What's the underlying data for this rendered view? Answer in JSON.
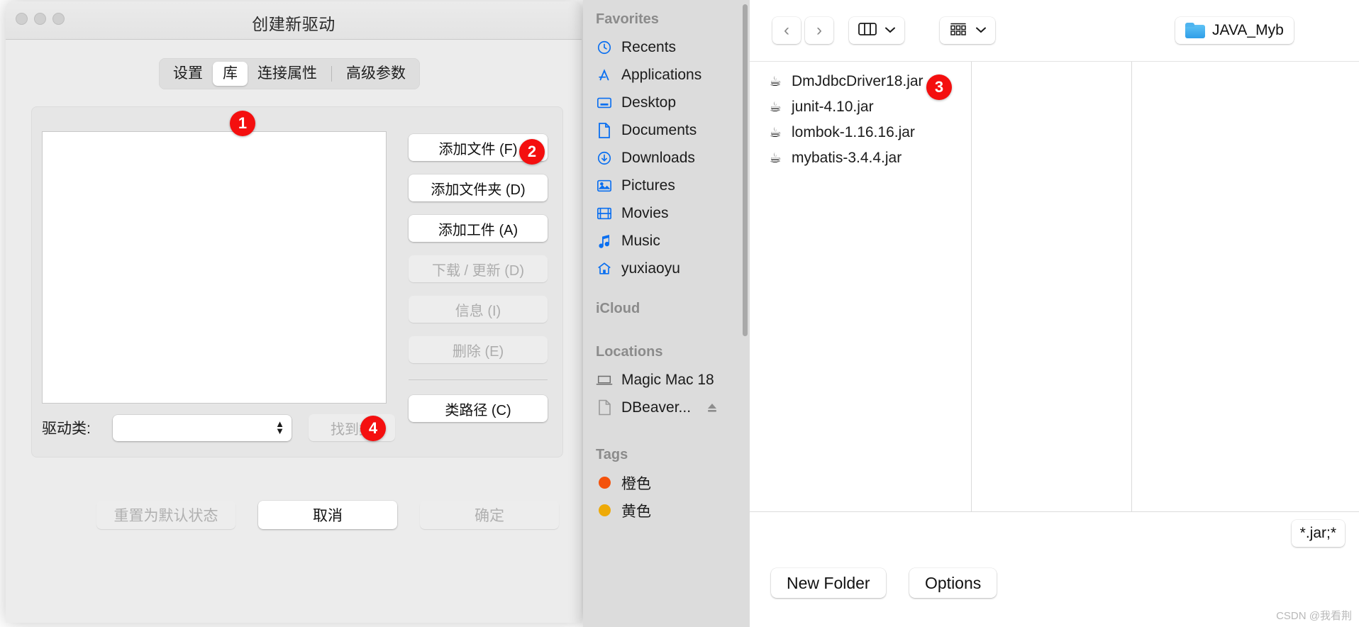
{
  "dialog": {
    "title": "创建新驱动",
    "tabs": [
      {
        "label": "设置",
        "active": false
      },
      {
        "label": "库",
        "active": true
      },
      {
        "label": "连接属性",
        "active": false
      },
      {
        "label": "高级参数",
        "active": false
      }
    ],
    "library_buttons": [
      {
        "label": "添加文件 (F)",
        "disabled": false
      },
      {
        "label": "添加文件夹 (D)",
        "disabled": false
      },
      {
        "label": "添加工件 (A)",
        "disabled": false
      },
      {
        "label": "下载 / 更新 (D)",
        "disabled": true
      },
      {
        "label": "信息 (I)",
        "disabled": true
      },
      {
        "label": "删除 (E)",
        "disabled": true
      }
    ],
    "classpath_button": "类路径 (C)",
    "driver_class_label": "驱动类:",
    "driver_class_value": "",
    "find_class_button": "找到类",
    "footer": {
      "reset": "重置为默认状态",
      "cancel": "取消",
      "ok": "确定"
    },
    "badges": [
      {
        "number": "1"
      },
      {
        "number": "2"
      },
      {
        "number": "3"
      },
      {
        "number": "4"
      }
    ]
  },
  "finder": {
    "sidebar": {
      "groups": [
        {
          "title": "Favorites",
          "items": [
            {
              "label": "Recents",
              "icon": "clock-icon",
              "color": "#0a6ff0"
            },
            {
              "label": "Applications",
              "icon": "appstore-icon",
              "color": "#0a6ff0"
            },
            {
              "label": "Desktop",
              "icon": "desktop-icon",
              "color": "#0a6ff0"
            },
            {
              "label": "Documents",
              "icon": "document-icon",
              "color": "#0a6ff0"
            },
            {
              "label": "Downloads",
              "icon": "download-icon",
              "color": "#0a6ff0"
            },
            {
              "label": "Pictures",
              "icon": "picture-icon",
              "color": "#0a6ff0"
            },
            {
              "label": "Movies",
              "icon": "film-icon",
              "color": "#0a6ff0"
            },
            {
              "label": "Music",
              "icon": "music-icon",
              "color": "#0a6ff0"
            },
            {
              "label": "yuxiaoyu",
              "icon": "home-icon",
              "color": "#0a6ff0"
            }
          ]
        },
        {
          "title": "iCloud",
          "items": []
        },
        {
          "title": "Locations",
          "items": [
            {
              "label": "Magic Mac 18",
              "icon": "laptop-icon",
              "color": "#777777"
            },
            {
              "label": "DBeaver...",
              "icon": "disk-image-icon",
              "color": "#9a9a9a",
              "eject": true
            }
          ]
        },
        {
          "title": "Tags",
          "items": [
            {
              "label": "橙色",
              "icon": "tag-dot-icon",
              "color": "#f4520c"
            },
            {
              "label": "黄色",
              "icon": "tag-dot-icon",
              "color": "#eeaa08"
            }
          ]
        }
      ]
    },
    "toolbar": {
      "back_icon": "chevron-left-icon",
      "forward_icon": "chevron-right-icon",
      "view_icon": "column-view-icon",
      "view_chevron": "chevron-down-icon",
      "group_icon": "group-view-icon",
      "group_chevron": "chevron-down-icon",
      "path_label": "JAVA_Myb",
      "path_icon": "folder-icon"
    },
    "files": [
      {
        "name": "DmJdbcDriver18.jar",
        "icon": "jar-icon"
      },
      {
        "name": "junit-4.10.jar",
        "icon": "jar-icon"
      },
      {
        "name": "lombok-1.16.16.jar",
        "icon": "jar-icon"
      },
      {
        "name": "mybatis-3.4.4.jar",
        "icon": "jar-icon"
      }
    ],
    "filter_value": "*.jar;*",
    "footer": {
      "new_folder": "New Folder",
      "options": "Options"
    }
  },
  "watermark": "CSDN @我看荆"
}
